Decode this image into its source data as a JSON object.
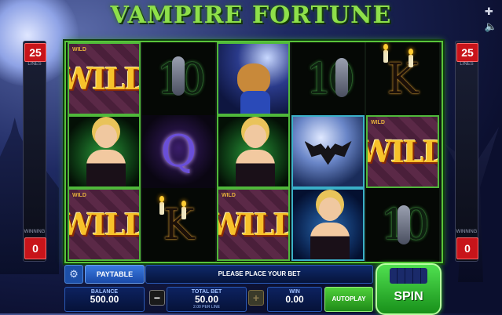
{
  "game": {
    "title": "VAMPIRE FORTUNE",
    "lines_value": "25",
    "lines_label": "LINES",
    "winning_label": "WINNING",
    "winning_value": "0"
  },
  "reels": [
    [
      "WILD",
      "LADY",
      "WILD"
    ],
    [
      "10",
      "Q",
      "K"
    ],
    [
      "WEREDOG",
      "LADY",
      "WILD"
    ],
    [
      "10",
      "BAT",
      "LADY"
    ],
    [
      "K",
      "WILD",
      "10"
    ]
  ],
  "symbols": {
    "wild_text": "WILD",
    "small_wild": "WILD",
    "ten_text": "10",
    "k_text": "K",
    "q_text": "Q"
  },
  "controls": {
    "paytable_label": "PAYTABLE",
    "message": "PLEASE PLACE YOUR BET",
    "balance_label": "BALANCE",
    "balance_value": "500.00",
    "total_bet_label": "TOTAL BET",
    "total_bet_value": "50.00",
    "per_line": "2.00 PER LINE",
    "win_label": "WIN",
    "win_value": "0.00",
    "autoplay_label": "AUTOPLAY",
    "spin_label": "SPIN"
  },
  "icons": [
    "gear-icon",
    "minus-icon",
    "plus-icon",
    "settings-cross-icon",
    "sound-icon"
  ]
}
